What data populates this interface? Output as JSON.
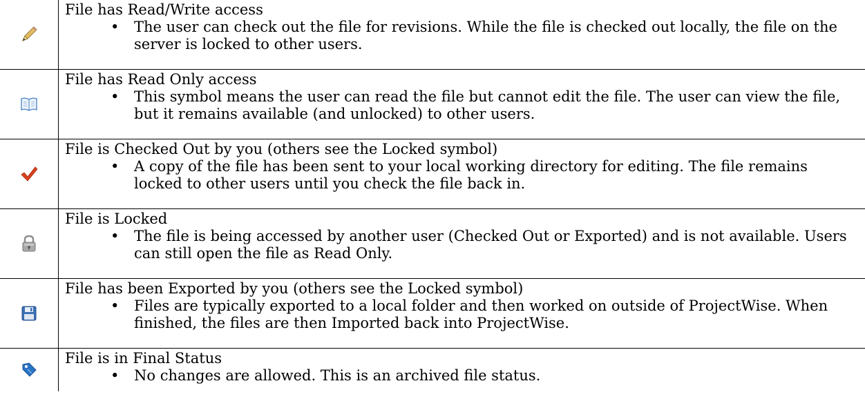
{
  "colors": {
    "pencil": "#d8b25a",
    "check": "#d9411e",
    "lock": "#8f8f8f",
    "disk": "#3b6fb5",
    "tag": "#2a74c6",
    "book": "#5b8fc8"
  },
  "rows": [
    {
      "icon": "pencil-icon",
      "title": "File has Read/Write access",
      "desc": "The user can check out the file for revisions. While the file is checked out locally, the file on the server is locked to other users."
    },
    {
      "icon": "open-book-icon",
      "title": "File has Read Only access",
      "desc": "This symbol means the user can read the file but cannot edit the file. The user can view the file, but it remains available (and unlocked) to other users."
    },
    {
      "icon": "checkmark-icon",
      "title": "File is Checked Out by you (others see the Locked symbol)",
      "desc": "A copy of the file has been sent to your local working directory for editing. The file remains locked to other users until you check the file back in."
    },
    {
      "icon": "padlock-icon",
      "title": "File is Locked",
      "desc": "The file is being accessed by another user (Checked Out or Exported) and is not available. Users can still open the file as Read Only."
    },
    {
      "icon": "floppy-disk-icon",
      "title": "File has been Exported by you (others see the Locked symbol)",
      "desc": "Files are typically exported to a local folder and then worked on outside of ProjectWise. When finished, the files are then Imported back into ProjectWise."
    },
    {
      "icon": "tag-icon",
      "title": "File is in Final Status",
      "desc": "No changes are allowed. This is an archived file status."
    }
  ]
}
